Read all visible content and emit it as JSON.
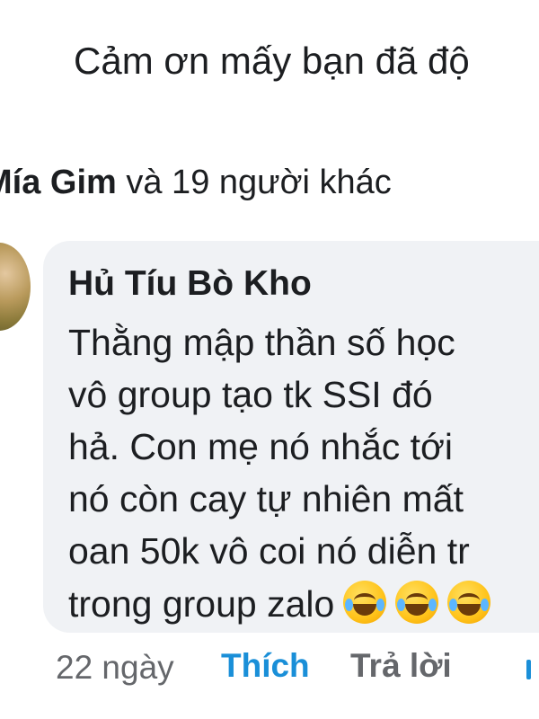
{
  "post": {
    "text_snippet": "Cảm ơn mấy bạn đã độ"
  },
  "reactions": {
    "name": "Mía Gim",
    "suffix": " và 19 người khác"
  },
  "comment": {
    "author": "Hủ Tíu Bò Kho",
    "lines": [
      "Thằng mập thần số học",
      "vô group tạo tk SSI  đó",
      "hả. Con mẹ nó nhắc tới",
      "nó còn cay tự nhiên mất",
      "oan 50k vô coi nó diễn tr",
      "trong group zalo"
    ],
    "emoji_names": [
      "rolling-on-floor-laughing",
      "rolling-on-floor-laughing",
      "rolling-on-floor-laughing"
    ],
    "time": "22 ngày",
    "like_label": "Thích",
    "reply_label": "Trả lời"
  },
  "colors": {
    "accent": "#1a8fd8",
    "muted": "#65676b",
    "bubble": "#f0f2f5",
    "text": "#1c1e21"
  }
}
